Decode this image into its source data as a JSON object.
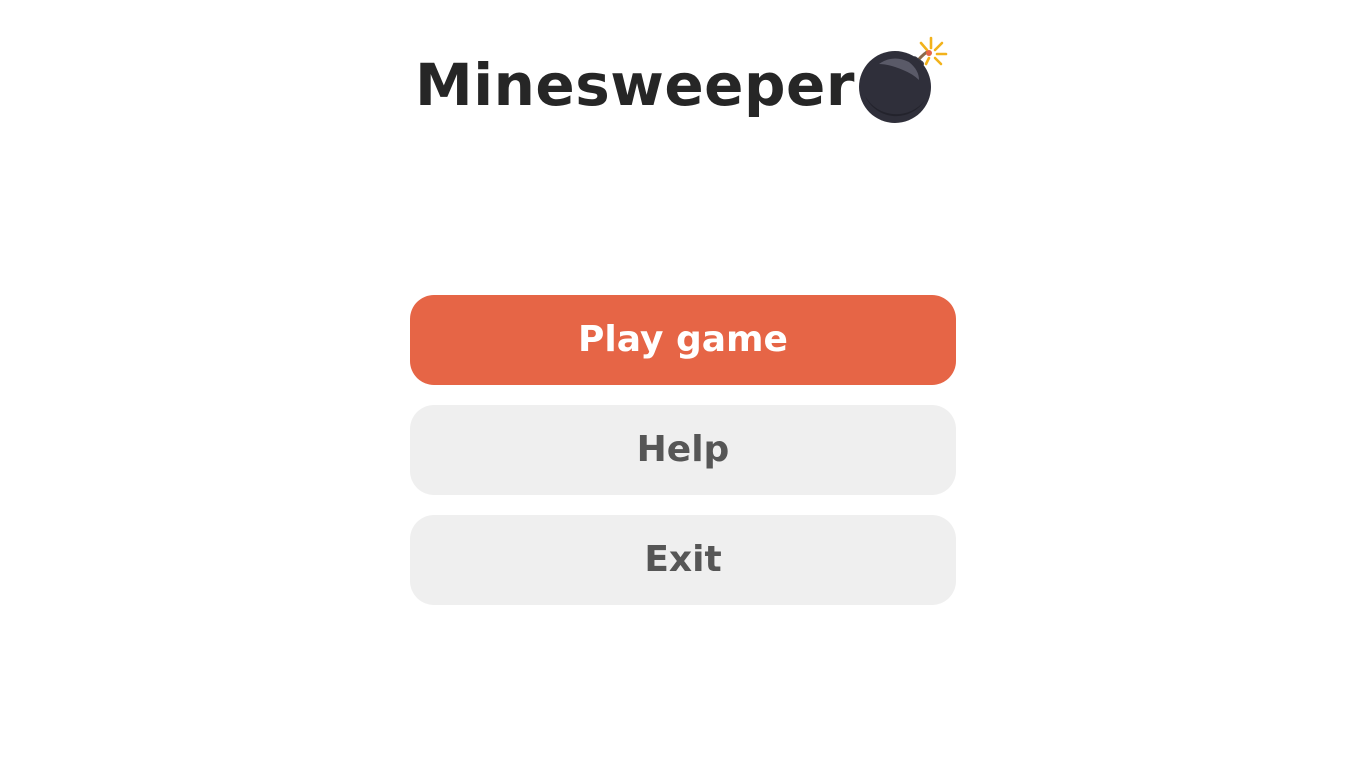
{
  "title": "Minesweeper",
  "title_icon": "bomb-icon",
  "colors": {
    "primary_button": "#e66546",
    "secondary_button": "#efefef",
    "title_text": "#262626",
    "secondary_text": "#565656",
    "bomb_body": "#2f2f3a",
    "spark": "#f2b21b"
  },
  "menu": {
    "play_label": "Play game",
    "help_label": "Help",
    "exit_label": "Exit"
  }
}
